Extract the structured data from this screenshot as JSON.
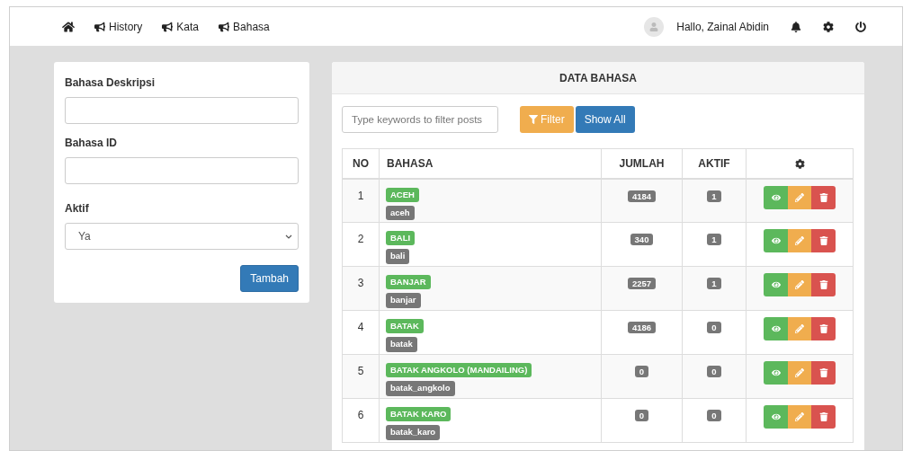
{
  "nav": {
    "items": [
      {
        "kind": "home"
      },
      {
        "kind": "link",
        "label": "History"
      },
      {
        "kind": "link",
        "label": "Kata"
      },
      {
        "kind": "link",
        "label": "Bahasa"
      }
    ],
    "greeting": "Hallo, Zainal Abidin"
  },
  "form": {
    "fields": [
      {
        "kind": "input",
        "label": "Bahasa Deskripsi"
      },
      {
        "kind": "input",
        "label": "Bahasa ID"
      },
      {
        "kind": "select",
        "label": "Aktif",
        "value": "Ya"
      }
    ],
    "submit": "Tambah"
  },
  "panel": {
    "title": "DATA BAHASA",
    "search": {
      "placeholder": "Type keywords to filter posts"
    },
    "filter": "Filter",
    "show_all": "Show All",
    "table": {
      "columns": [
        "NO",
        "BAHASA",
        "JUMLAH",
        "AKTIF"
      ],
      "rows": [
        {
          "no": "1",
          "name": "ACEH",
          "id": "aceh",
          "jumlah": "4184",
          "aktif": "1"
        },
        {
          "no": "2",
          "name": "BALI",
          "id": "bali",
          "jumlah": "340",
          "aktif": "1"
        },
        {
          "no": "3",
          "name": "BANJAR",
          "id": "banjar",
          "jumlah": "2257",
          "aktif": "1"
        },
        {
          "no": "4",
          "name": "BATAK",
          "id": "batak",
          "jumlah": "4186",
          "aktif": "0"
        },
        {
          "no": "5",
          "name": "BATAK ANGKOLO (MANDAILING)",
          "id": "batak_angkolo",
          "jumlah": "0",
          "aktif": "0"
        },
        {
          "no": "6",
          "name": "BATAK KARO",
          "id": "batak_karo",
          "jumlah": "0",
          "aktif": "0"
        }
      ]
    }
  }
}
